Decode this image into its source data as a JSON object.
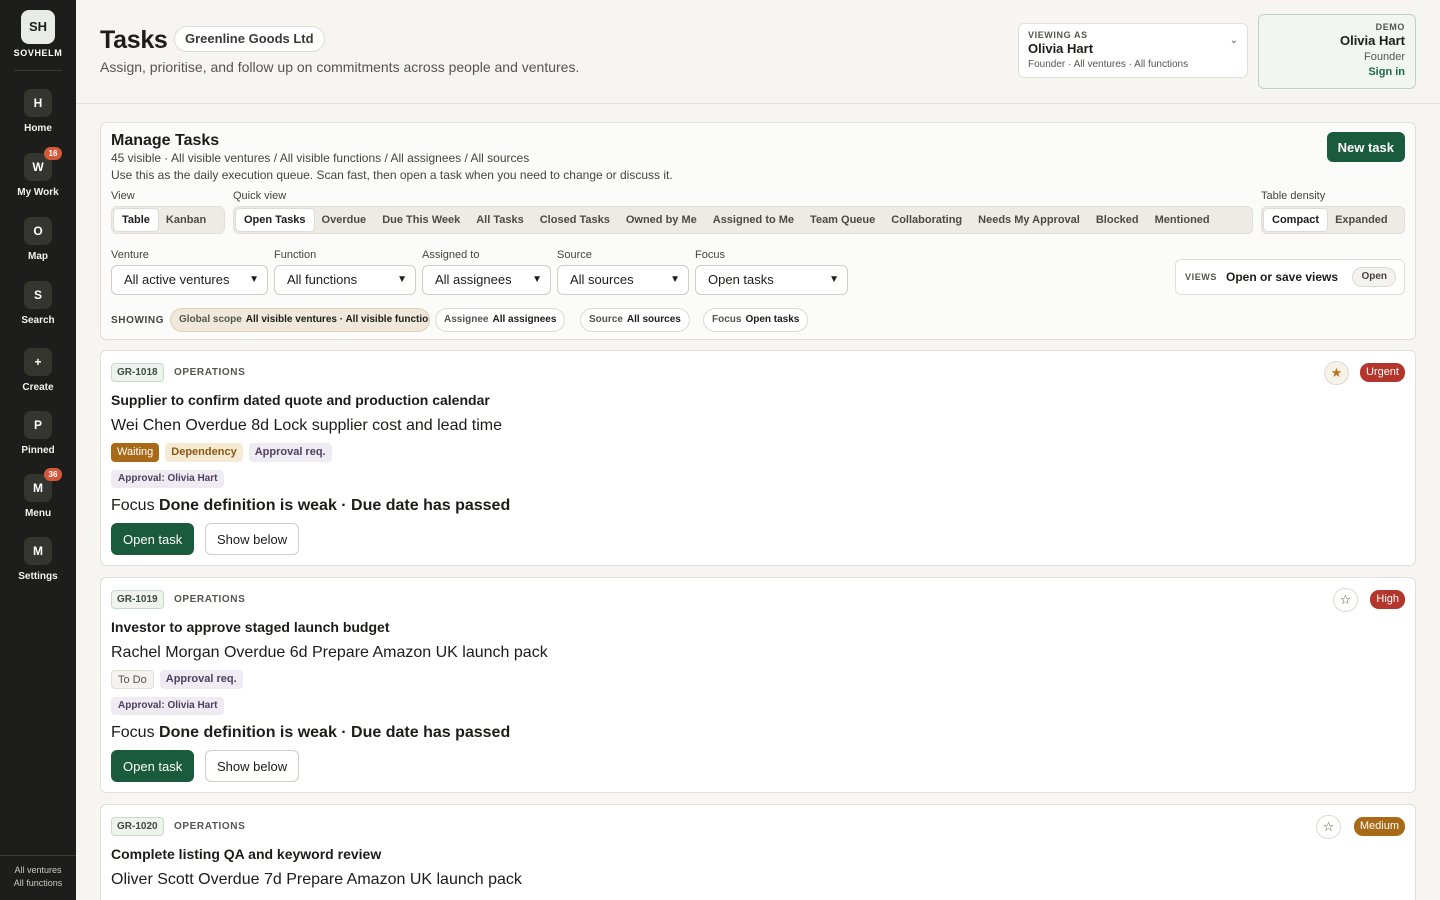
{
  "brand": {
    "initials": "SH",
    "name": "SOVHELM"
  },
  "nav": [
    {
      "icon": "H",
      "label": "Home",
      "badge": ""
    },
    {
      "icon": "W",
      "label": "My Work",
      "badge": "16"
    },
    {
      "icon": "O",
      "label": "Map",
      "badge": ""
    },
    {
      "icon": "S",
      "label": "Search",
      "badge": ""
    },
    {
      "icon": "+",
      "label": "Create",
      "badge": ""
    },
    {
      "icon": "P",
      "label": "Pinned",
      "badge": ""
    },
    {
      "icon": "M",
      "label": "Menu",
      "badge": "36"
    },
    {
      "icon": "M",
      "label": "Settings",
      "badge": ""
    }
  ],
  "sidebar_footer": {
    "line1": "All ventures",
    "line2": "All functions"
  },
  "header": {
    "title": "Tasks",
    "org": "Greenline Goods Ltd",
    "subtitle": "Assign, prioritise, and follow up on commitments across people and ventures.",
    "viewing": {
      "kicker": "VIEWING AS",
      "name": "Olivia Hart",
      "meta": "Founder · All ventures · All functions"
    },
    "demo": {
      "kicker": "DEMO",
      "name": "Olivia Hart",
      "role": "Founder",
      "signin": "Sign in"
    }
  },
  "manage": {
    "title": "Manage Tasks",
    "meta": "45 visible · All visible ventures / All visible functions / All assignees / All sources",
    "help": "Use this as the daily execution queue. Scan fast, then open a task when you need to change or discuss it.",
    "new_task": "New task",
    "view_label": "View",
    "views": [
      "Table",
      "Kanban"
    ],
    "quick_label": "Quick view",
    "quick_views": [
      "Open Tasks",
      "Overdue",
      "Due This Week",
      "All Tasks",
      "Closed Tasks",
      "Owned by Me",
      "Assigned to Me",
      "Team Queue",
      "Collaborating",
      "Needs My Approval",
      "Blocked",
      "Mentioned"
    ],
    "density_label": "Table density",
    "densities": [
      "Compact",
      "Expanded"
    ],
    "filters": {
      "venture": {
        "label": "Venture",
        "value": "All active ventures"
      },
      "function": {
        "label": "Function",
        "value": "All functions"
      },
      "assigned": {
        "label": "Assigned to",
        "value": "All assignees"
      },
      "source": {
        "label": "Source",
        "value": "All sources"
      },
      "focus": {
        "label": "Focus",
        "value": "Open tasks"
      }
    },
    "views_box": {
      "kicker": "VIEWS",
      "text": "Open or save views",
      "button": "Open"
    },
    "showing": {
      "label": "SHOWING",
      "global": {
        "k": "Global scope",
        "v": "All visible ventures · All visible functions"
      },
      "assignee": {
        "k": "Assignee",
        "v": "All assignees"
      },
      "source": {
        "k": "Source",
        "v": "All sources"
      },
      "focus": {
        "k": "Focus",
        "v": "Open tasks"
      }
    }
  },
  "tasks": [
    {
      "id": "GR-1018",
      "function": "OPERATIONS",
      "starred": true,
      "priority": "Urgent",
      "priority_color": "#b3352b",
      "title": "Supplier to confirm dated quote and production calendar",
      "line": "Wei Chen Overdue 8d Lock supplier cost and lead time",
      "tags": [
        {
          "text": "Waiting",
          "kind": "waiting"
        },
        {
          "text": "Dependency",
          "kind": "dep"
        },
        {
          "text": "Approval req.",
          "kind": "approval"
        }
      ],
      "approval": "Approval: Olivia Hart",
      "focus_prefix": "Focus",
      "focus_text": "Done definition is weak · Due date has passed",
      "open": "Open task",
      "show": "Show below"
    },
    {
      "id": "GR-1019",
      "function": "OPERATIONS",
      "starred": false,
      "priority": "High",
      "priority_color": "#b3352b",
      "title": "Investor to approve staged launch budget",
      "line": "Rachel Morgan Overdue 6d Prepare Amazon UK launch pack",
      "tags": [
        {
          "text": "To Do",
          "kind": "todo"
        },
        {
          "text": "Approval req.",
          "kind": "approval"
        }
      ],
      "approval": "Approval: Olivia Hart",
      "focus_prefix": "Focus",
      "focus_text": "Done definition is weak · Due date has passed",
      "open": "Open task",
      "show": "Show below"
    },
    {
      "id": "GR-1020",
      "function": "OPERATIONS",
      "starred": false,
      "priority": "Medium",
      "priority_color": "#a86a16",
      "title": "Complete listing QA and keyword review",
      "line": "Oliver Scott Overdue 7d Prepare Amazon UK launch pack",
      "tags": [],
      "approval": "",
      "focus_prefix": "",
      "focus_text": "",
      "open": "",
      "show": ""
    }
  ]
}
